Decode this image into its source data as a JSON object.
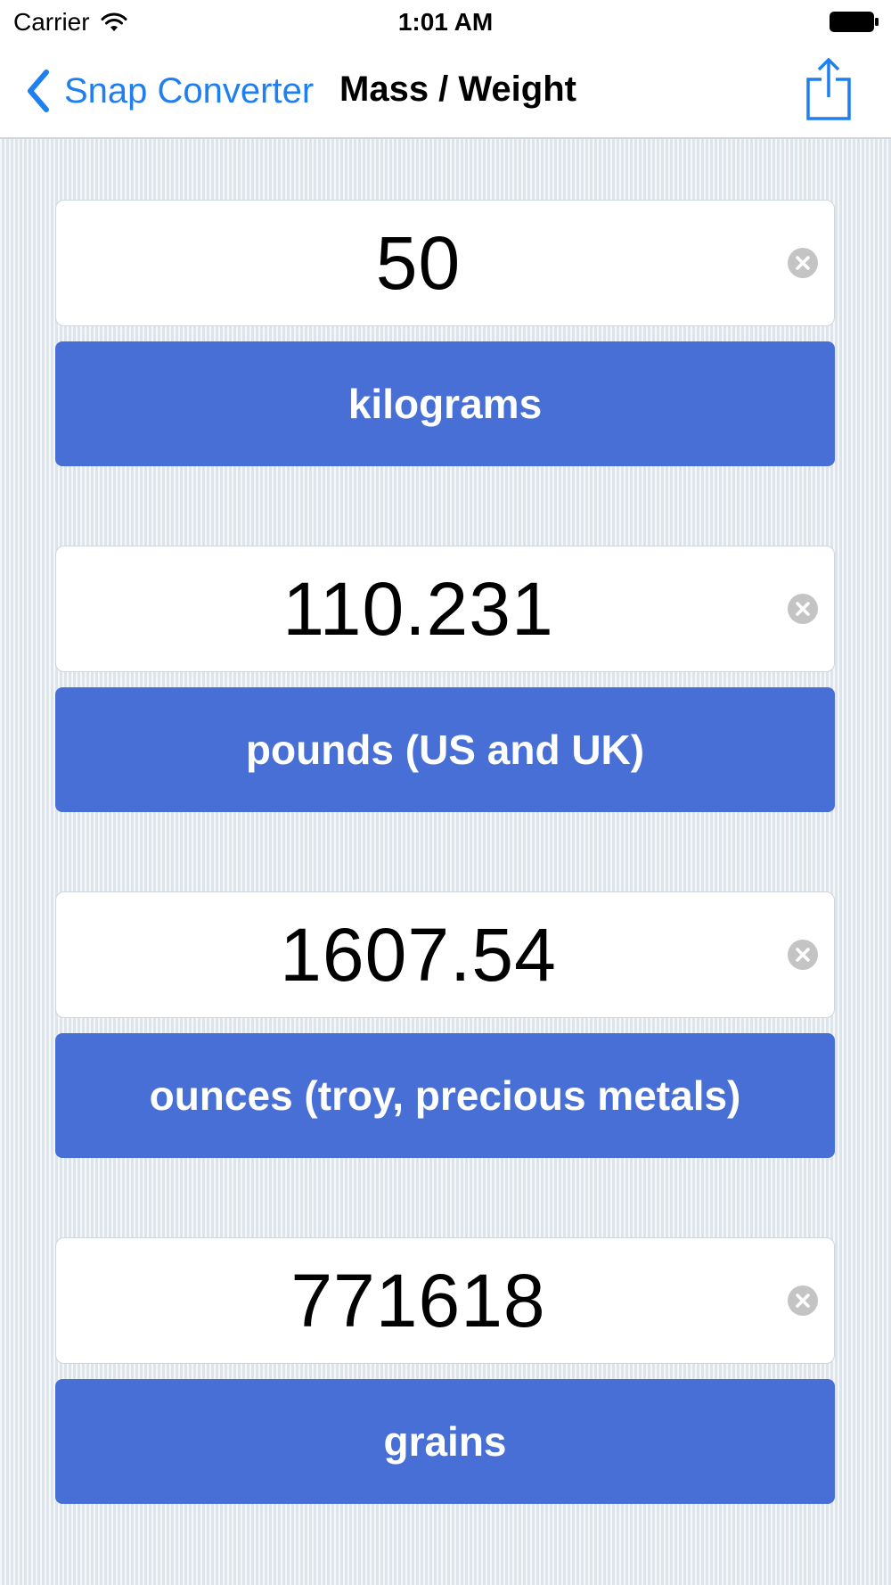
{
  "status_bar": {
    "carrier": "Carrier",
    "time": "1:01 AM"
  },
  "nav": {
    "back_label": "Snap Converter",
    "title": "Mass / Weight"
  },
  "colors": {
    "accent": "#1f7ff0",
    "unit_button": "#476fd6",
    "background": "#e8eef3"
  },
  "conversions": [
    {
      "value": "50",
      "unit": "kilograms"
    },
    {
      "value": "110.231",
      "unit": "pounds (US and UK)"
    },
    {
      "value": "1607.54",
      "unit": "ounces (troy, precious metals)"
    },
    {
      "value": "771618",
      "unit": "grains"
    }
  ]
}
